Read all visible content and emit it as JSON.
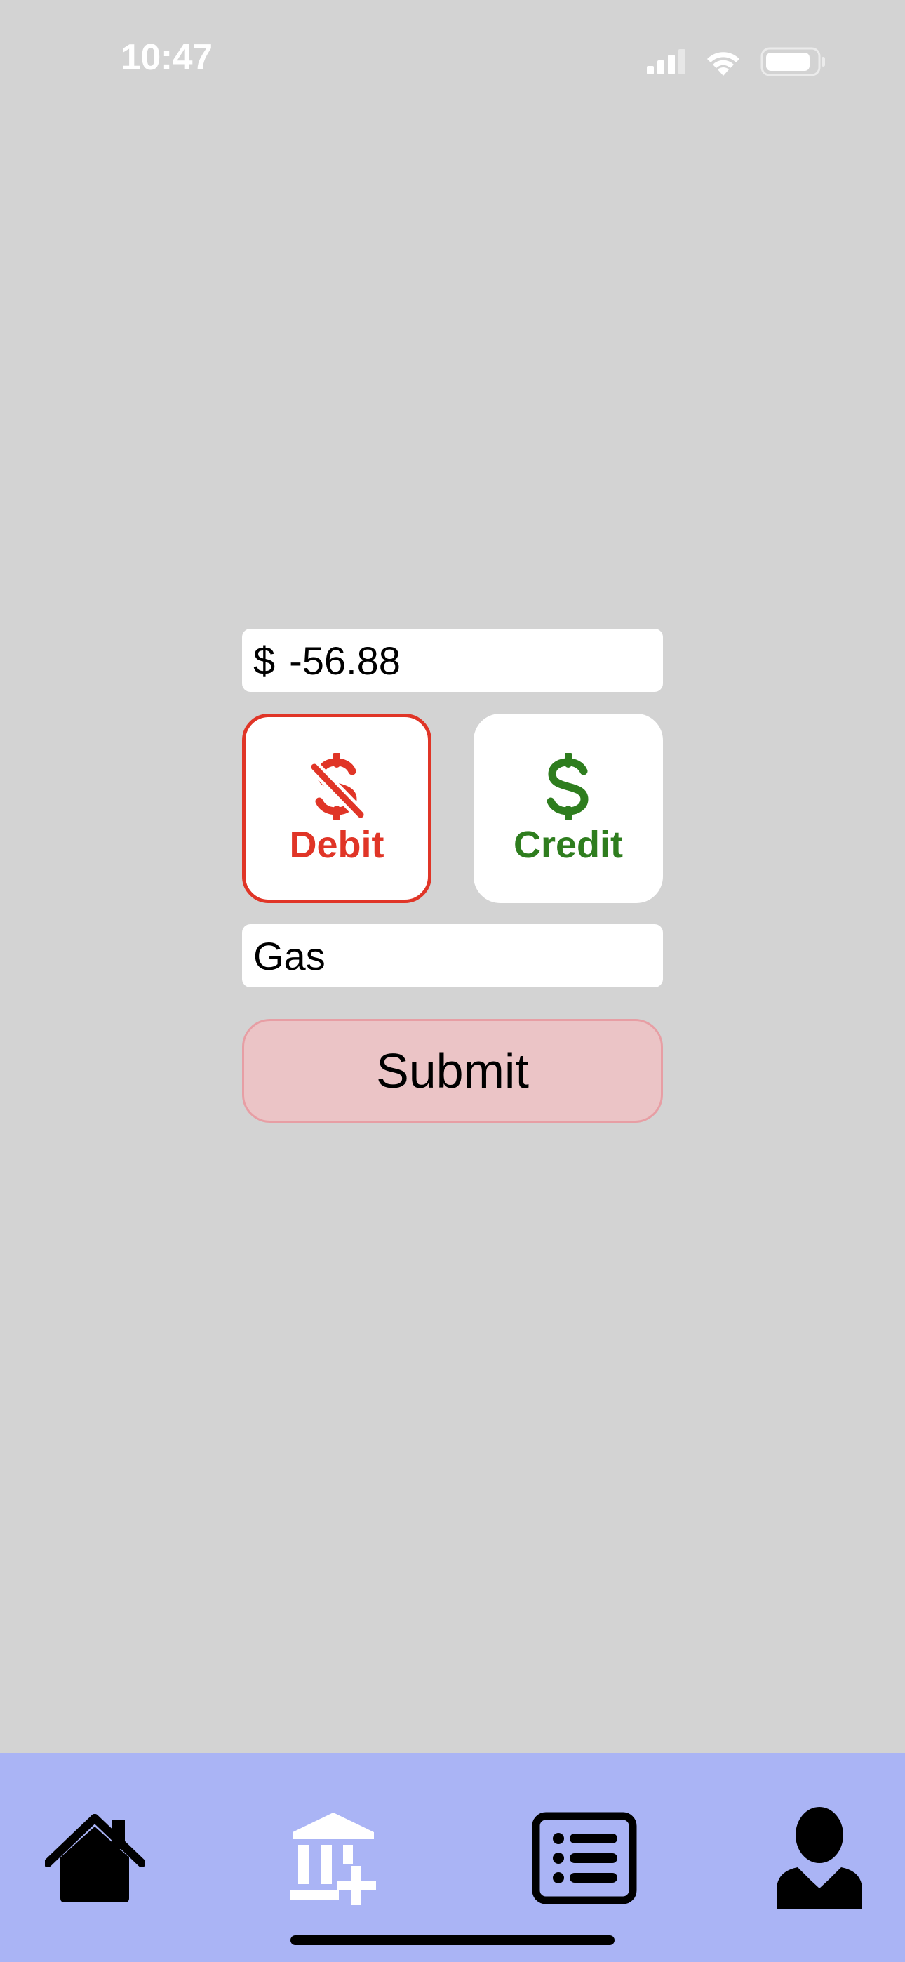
{
  "status_bar": {
    "time": "10:47",
    "icons": [
      "cellular-signal-icon",
      "wifi-icon",
      "battery-icon"
    ]
  },
  "form": {
    "amount": {
      "prefix": "$",
      "value": "-56.88"
    },
    "transaction_types": [
      {
        "label": "Debit",
        "icon": "dollar-slash-icon",
        "color": "#e03527",
        "selected": true
      },
      {
        "label": "Credit",
        "icon": "dollar-icon",
        "color": "#2e7d1e",
        "selected": false
      }
    ],
    "description": {
      "value": "Gas"
    },
    "submit_label": "Submit"
  },
  "tab_bar": {
    "background": "#aab4f5",
    "tabs": [
      {
        "name": "home",
        "icon": "house-icon"
      },
      {
        "name": "add-account",
        "icon": "bank-plus-icon"
      },
      {
        "name": "transactions",
        "icon": "list-icon"
      },
      {
        "name": "profile",
        "icon": "person-icon"
      }
    ]
  },
  "colors": {
    "background": "#d3d3d3",
    "debit": "#e03527",
    "credit": "#2e7d1e",
    "submit_fill": "#ebc4c6",
    "submit_border": "#e79ea4"
  }
}
